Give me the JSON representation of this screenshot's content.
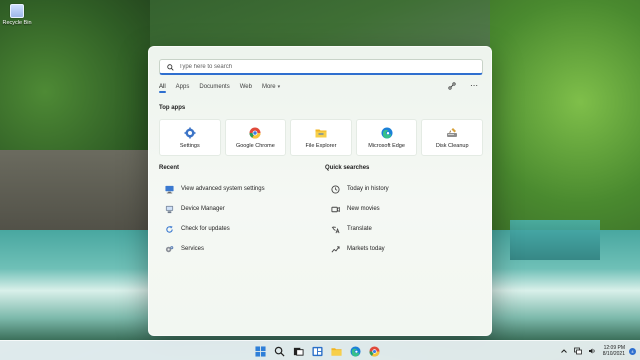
{
  "desktop": {
    "icons": [
      {
        "label": "Recycle Bin",
        "icon": "recycle-bin-icon"
      }
    ]
  },
  "search_panel": {
    "placeholder": "Type here to search",
    "tabs": [
      {
        "label": "All",
        "active": true
      },
      {
        "label": "Apps",
        "active": false
      },
      {
        "label": "Documents",
        "active": false
      },
      {
        "label": "Web",
        "active": false
      },
      {
        "label": "More",
        "active": false
      }
    ],
    "top_apps_title": "Top apps",
    "top_apps": [
      {
        "label": "Settings",
        "icon": "gear-icon"
      },
      {
        "label": "Google Chrome",
        "icon": "chrome-icon"
      },
      {
        "label": "File Explorer",
        "icon": "folder-icon"
      },
      {
        "label": "Microsoft Edge",
        "icon": "edge-icon"
      },
      {
        "label": "Disk Cleanup",
        "icon": "disk-cleanup-icon"
      }
    ],
    "recent_title": "Recent",
    "recent": [
      {
        "label": "View advanced system settings",
        "icon": "monitor-settings-icon"
      },
      {
        "label": "Device Manager",
        "icon": "device-manager-icon"
      },
      {
        "label": "Check for updates",
        "icon": "refresh-icon"
      },
      {
        "label": "Services",
        "icon": "services-gear-icon"
      }
    ],
    "quick_title": "Quick searches",
    "quick": [
      {
        "label": "Today in history",
        "icon": "clock-icon"
      },
      {
        "label": "New movies",
        "icon": "movie-icon"
      },
      {
        "label": "Translate",
        "icon": "translate-icon"
      },
      {
        "label": "Markets today",
        "icon": "chart-icon"
      }
    ]
  },
  "taskbar": {
    "pinned": [
      {
        "name": "start",
        "icon": "windows-start-icon"
      },
      {
        "name": "search",
        "icon": "search-icon"
      },
      {
        "name": "task-view",
        "icon": "task-view-icon"
      },
      {
        "name": "widgets",
        "icon": "widgets-icon"
      },
      {
        "name": "file-explorer",
        "icon": "folder-icon"
      },
      {
        "name": "edge",
        "icon": "edge-icon"
      },
      {
        "name": "chrome",
        "icon": "chrome-icon"
      }
    ],
    "tray": {
      "time": "12:09 PM",
      "date": "8/10/2021",
      "notification_count": "4"
    }
  },
  "colors": {
    "accent": "#2f6fcf",
    "panel_bg": "#f3f7f2"
  }
}
